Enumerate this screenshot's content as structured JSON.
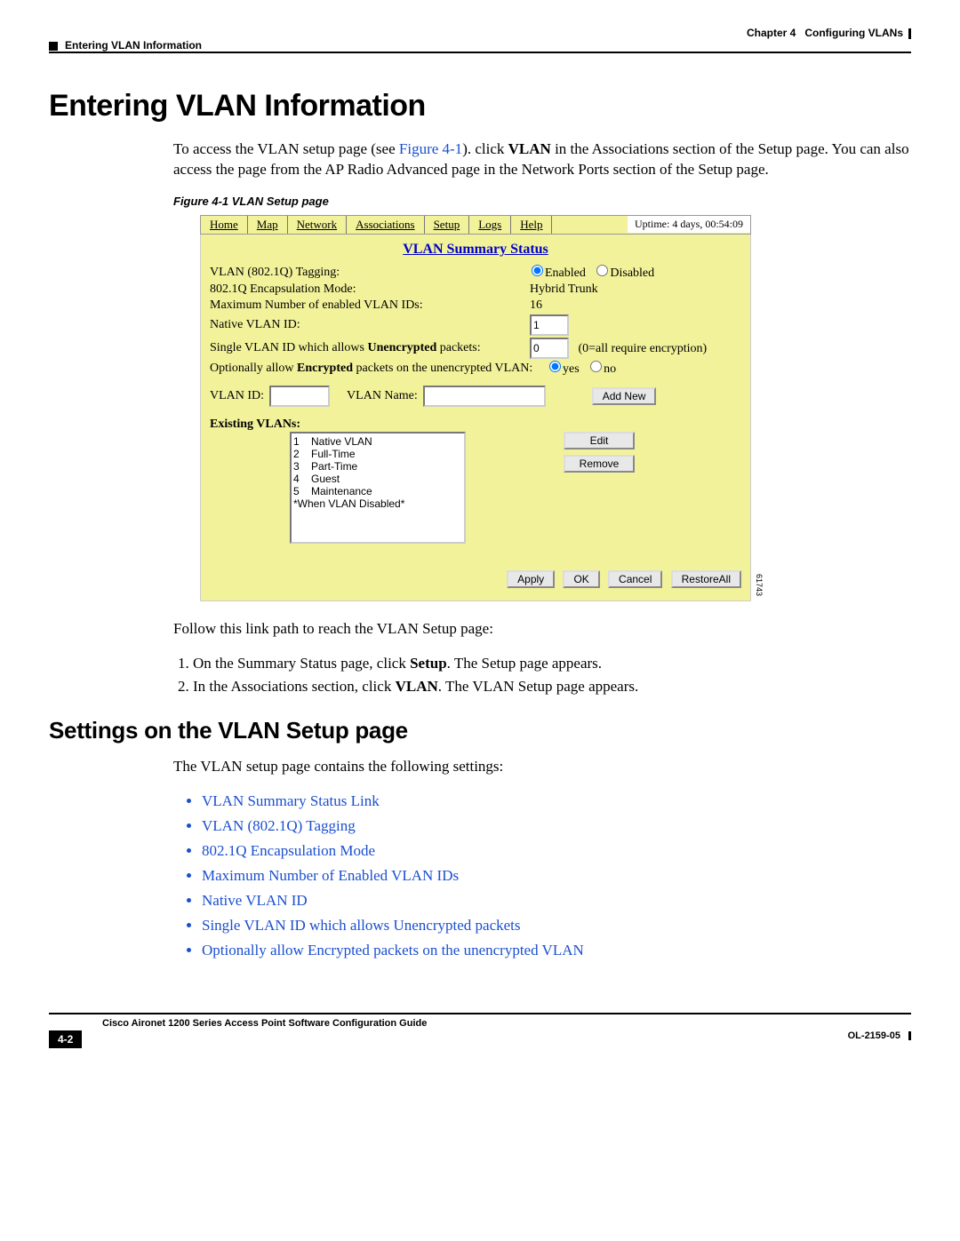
{
  "header": {
    "chapter": "Chapter 4",
    "chapter_title": "Configuring VLANs",
    "section": "Entering VLAN Information"
  },
  "title": "Entering VLAN Information",
  "intro_1": "To access the VLAN setup page (see ",
  "intro_fig_ref": "Figure 4-1",
  "intro_2": "). click ",
  "intro_bold": "VLAN",
  "intro_3": " in the Associations section of the Setup page. You can also access the page from the AP Radio Advanced page in the Network Ports section of the Setup page.",
  "figure_caption": "Figure 4-1    VLAN Setup page",
  "figure": {
    "nav": [
      "Home",
      "Map",
      "Network",
      "Associations",
      "Setup",
      "Logs",
      "Help"
    ],
    "uptime": "Uptime: 4 days, 00:54:09",
    "summary_title": "VLAN Summary Status",
    "rows": {
      "tagging_label": "VLAN (802.1Q) Tagging:",
      "enabled": "Enabled",
      "disabled": "Disabled",
      "encap_label": "802.1Q Encapsulation Mode:",
      "encap_value": "Hybrid Trunk",
      "max_label": "Maximum Number of enabled VLAN IDs:",
      "max_value": "16",
      "native_label": "Native VLAN ID:",
      "native_value": "1",
      "single_label_1": "Single VLAN ID which allows ",
      "single_label_bold": "Unencrypted",
      "single_label_2": " packets:",
      "single_value": "0",
      "single_note": "(0=all require encryption)",
      "opt_label_1": "Optionally allow ",
      "opt_label_bold": "Encrypted",
      "opt_label_2": " packets on the unencrypted VLAN:",
      "yes": "yes",
      "no": "no"
    },
    "add": {
      "vlan_id_label": "VLAN ID:",
      "vlan_name_label": "VLAN Name:",
      "add_btn": "Add New"
    },
    "existing_label": "Existing VLANs:",
    "existing_list": [
      "1    Native VLAN",
      "2    Full-Time",
      "3    Part-Time",
      "4    Guest",
      "5    Maintenance",
      "*When VLAN Disabled*"
    ],
    "edit_btn": "Edit",
    "remove_btn": "Remove",
    "bottom_btns": [
      "Apply",
      "OK",
      "Cancel",
      "RestoreAll"
    ],
    "fig_id": "61743"
  },
  "follow_text": "Follow this link path to reach the VLAN Setup page:",
  "steps": [
    {
      "pre": "On the Summary Status page, click ",
      "bold": "Setup",
      "post": ". The Setup page appears."
    },
    {
      "pre": "In the Associations section, click ",
      "bold": "VLAN",
      "post": ". The VLAN Setup page appears."
    }
  ],
  "subtitle": "Settings on the VLAN Setup page",
  "settings_intro": "The VLAN setup page contains the following settings:",
  "bullets": [
    "VLAN Summary Status Link",
    "VLAN (802.1Q) Tagging",
    "802.1Q Encapsulation Mode",
    "Maximum Number of Enabled VLAN IDs",
    "Native VLAN ID",
    "Single VLAN ID which allows Unencrypted packets",
    "Optionally allow Encrypted packets on the unencrypted VLAN"
  ],
  "footer": {
    "guide": "Cisco Aironet 1200 Series Access Point Software Configuration Guide",
    "page_num": "4-2",
    "ol": "OL-2159-05"
  }
}
